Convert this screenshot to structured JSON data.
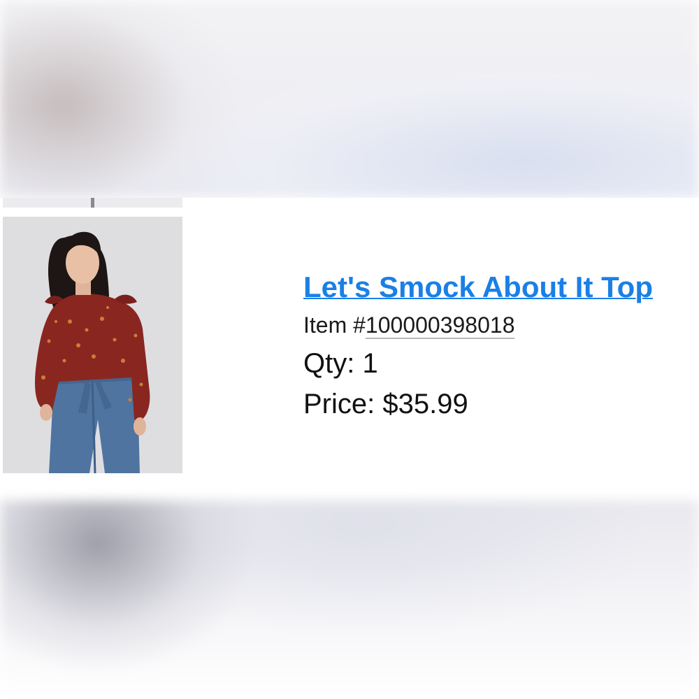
{
  "order_item": {
    "product_name": "Let's Smock About It Top",
    "item_prefix": "Item #",
    "item_number": "100000398018",
    "qty_label": "Qty: ",
    "qty_value": "1",
    "price_label": "Price: ",
    "price_value": "$35.99"
  },
  "colors": {
    "link": "#1a7fe6",
    "blouse": "#8a2620",
    "jeans": "#4f74a0"
  }
}
